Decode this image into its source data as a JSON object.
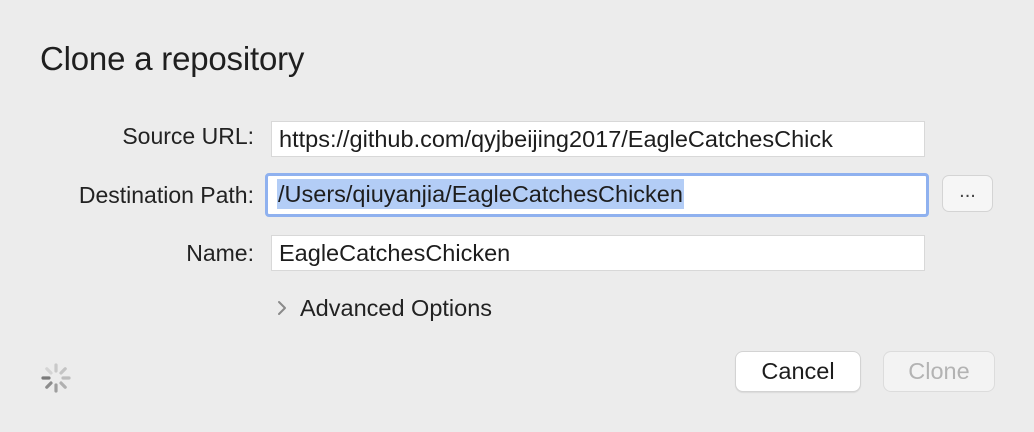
{
  "dialog": {
    "title": "Clone a repository",
    "source_url": {
      "label": "Source URL:",
      "value": "https://github.com/qyjbeijing2017/EagleCatchesChick"
    },
    "destination_path": {
      "label": "Destination Path:",
      "value": "/Users/qiuyanjia/EagleCatchesChicken",
      "browse_label": "..."
    },
    "name": {
      "label": "Name:",
      "value": "EagleCatchesChicken"
    },
    "advanced_options_label": "Advanced Options",
    "buttons": {
      "cancel_label": "Cancel",
      "clone_label": "Clone"
    }
  },
  "colors": {
    "focus_ring": "#8fb1ef",
    "selection": "#b3cdf6",
    "disabled_text": "#b3b3b3"
  },
  "icons": {
    "advanced_toggle": "chevron-right-icon",
    "loading": "spinner-icon"
  }
}
